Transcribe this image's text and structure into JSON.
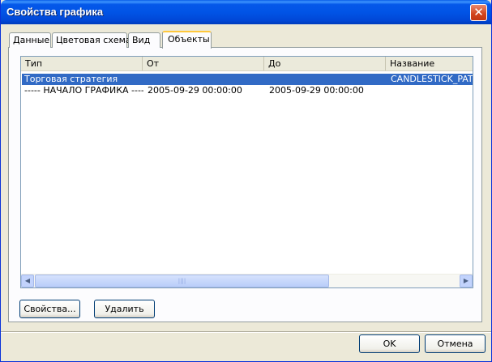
{
  "window": {
    "title": "Свойства графика",
    "close_symbol": "✕"
  },
  "tabs": [
    {
      "label": "Данные"
    },
    {
      "label": "Цветовая схема"
    },
    {
      "label": "Вид"
    },
    {
      "label": "Объекты",
      "active": true
    }
  ],
  "list": {
    "columns": [
      "Тип",
      "От",
      "До",
      "Название"
    ],
    "rows": [
      {
        "type": "Торговая стратегия",
        "from": "",
        "to": "",
        "name": "CANDLESTICK_PATTE",
        "selected": true
      },
      {
        "type": "----- НАЧАЛО ГРАФИКА -----",
        "from": "2005-09-29 00:00:00",
        "to": "2005-09-29 00:00:00",
        "name": "",
        "selected": false
      }
    ],
    "scrollbar": {
      "left_arrow": "◀",
      "right_arrow": "▶",
      "grip": "||||"
    }
  },
  "buttons": {
    "properties": "Свойства...",
    "delete": "Удалить",
    "ok": "OK",
    "cancel": "Отмена"
  },
  "colors": {
    "selection": "#316ac5",
    "titlebar": "#0154e6"
  }
}
